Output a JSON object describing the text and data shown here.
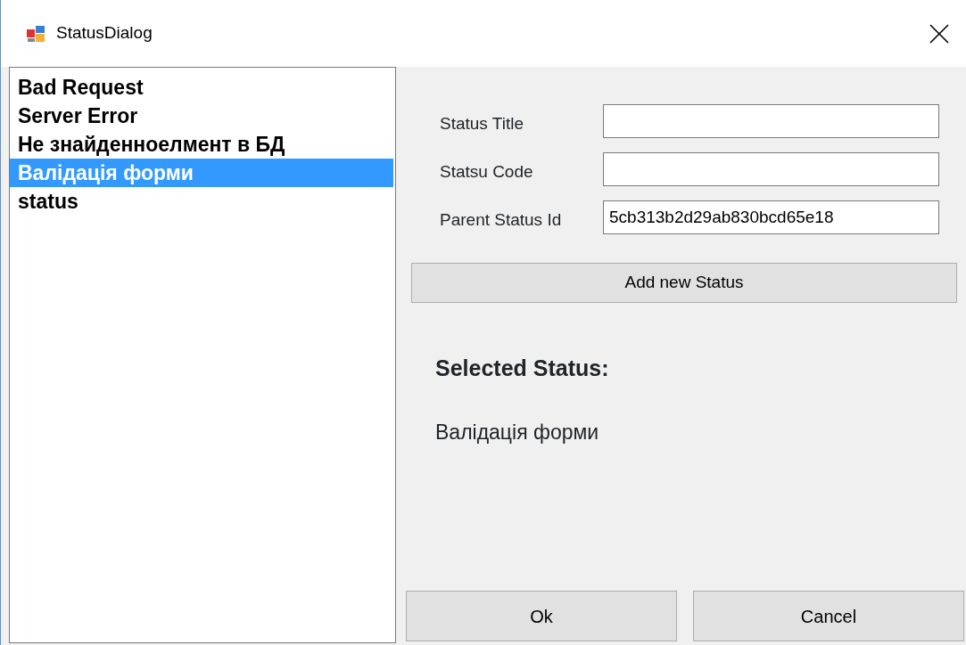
{
  "window": {
    "title": "StatusDialog"
  },
  "status_list": [
    {
      "label": "Bad Request",
      "selected": false
    },
    {
      "label": "Server Error",
      "selected": false
    },
    {
      "label": "Не знайденноелмент в БД",
      "selected": false
    },
    {
      "label": "Валідація форми",
      "selected": true
    },
    {
      "label": "status",
      "selected": false
    }
  ],
  "form": [
    {
      "label": "Status Title"
    },
    {
      "label": "Statsu Code"
    },
    {
      "label": "Parent Status Id",
      "value": "5cb313b2d29ab830bcd65e18"
    }
  ],
  "add_button": "Add new Status",
  "selected_heading": "Selected Status:",
  "selected_value": "Валідація форми",
  "buttons": [
    "Ok",
    "Cancel"
  ]
}
